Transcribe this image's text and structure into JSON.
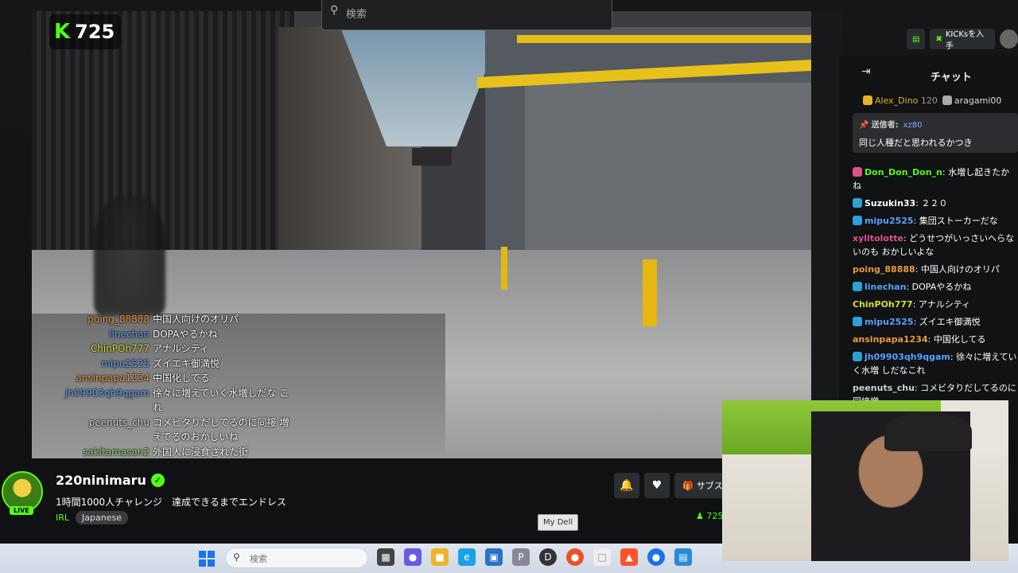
{
  "search": {
    "placeholder": "検索"
  },
  "viewer_badge": {
    "count": "725"
  },
  "top_right": {
    "kicks_label": "KICKsを入手"
  },
  "video_overlay_chat": [
    {
      "user": "poing_88888",
      "msg": "中国人向けのオリパ",
      "color": "#e89a3c"
    },
    {
      "user": "linechan",
      "msg": "DOPAやるかね",
      "color": "#5aa0ff"
    },
    {
      "user": "ChinPOh777",
      "msg": "アナルシティ",
      "color": "#d6e02a"
    },
    {
      "user": "mipu2525",
      "msg": "ズイエキ御満悦",
      "color": "#5aa0ff"
    },
    {
      "user": "ansinpapa1234",
      "msg": "中国化してる",
      "color": "#e89a3c"
    },
    {
      "user": "jh09903qh9qgam",
      "msg": "徐々に増えていく水増しだな これ",
      "color": "#5aa0ff"
    },
    {
      "user": "peenuts_chu",
      "msg": "コメビタりだしてるのに同接 増えてるのおかしいね",
      "color": "#cfcfcf"
    },
    {
      "user": "sakitamasan2",
      "msg": "外国人に浸食された街",
      "color": "#8cd17a"
    }
  ],
  "chat": {
    "title": "チャット",
    "pinned_users": [
      {
        "name": "Alex_Dino",
        "count": "120"
      },
      {
        "name": "aragami00",
        "count": ""
      }
    ],
    "pinned": {
      "header": "送信者:",
      "sender": "xz80",
      "message": "同じ人種だと思われるかつき"
    },
    "messages": [
      {
        "user": "Don_Don_Don_n",
        "msg": "水増し起きたかね",
        "color": "#53fc18",
        "badge": "#e0508a"
      },
      {
        "user": "Suzukin33",
        "msg": "２２０",
        "color": "#ffffff",
        "badge": "#2ea0d8"
      },
      {
        "user": "mipu2525",
        "msg": "集団ストーカーだな",
        "color": "#5aa0ff",
        "badge": "#2ea0d8"
      },
      {
        "user": "xylitolotte",
        "msg": "どうせつがいっさいへらないのも おかしいよな",
        "color": "#e0508a",
        "badge": ""
      },
      {
        "user": "poing_88888",
        "msg": "中国人向けのオリパ",
        "color": "#e89a3c",
        "badge": ""
      },
      {
        "user": "linechan",
        "msg": "DOPAやるかね",
        "color": "#5aa0ff",
        "badge": "#2ea0d8"
      },
      {
        "user": "ChinPOh777",
        "msg": "アナルシティ",
        "color": "#d6e02a",
        "badge": ""
      },
      {
        "user": "mipu2525",
        "msg": "ズイエキ御満悦",
        "color": "#5aa0ff",
        "badge": "#2ea0d8"
      },
      {
        "user": "ansinpapa1234",
        "msg": "中国化してる",
        "color": "#e89a3c",
        "badge": ""
      },
      {
        "user": "jh09903qh9qgam",
        "msg": "徐々に増えていく水増 しだなこれ",
        "color": "#5aa0ff",
        "badge": "#2ea0d8"
      },
      {
        "user": "peenuts_chu",
        "msg": "コメビタりだしてるのに同接増",
        "color": "#cfcfcf",
        "badge": ""
      }
    ]
  },
  "channel": {
    "name": "220ninimaru",
    "live": "LIVE",
    "title": "1時間1000人チャレンジ　達成できるまでエンドレス",
    "category": "IRL",
    "tag": "Japanese",
    "subscribe_label": "サブスク",
    "viewers": "725"
  },
  "tooltip": "My Dell",
  "taskbar": {
    "search_placeholder": "検索"
  },
  "colors": {
    "kick_green": "#53fc18"
  }
}
